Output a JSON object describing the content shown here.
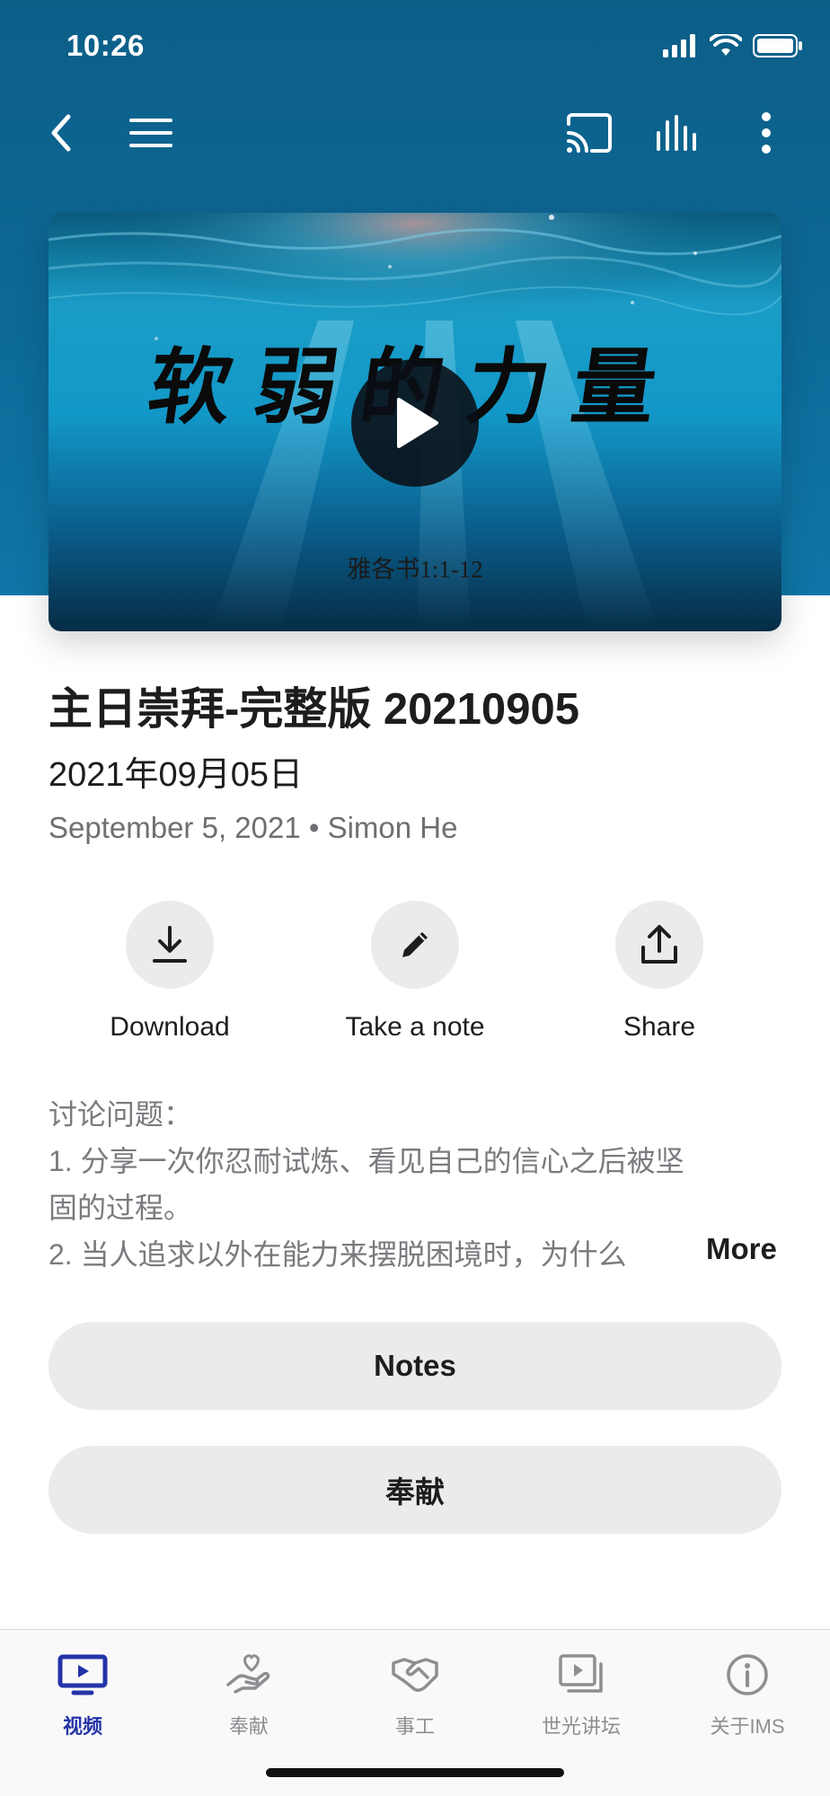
{
  "status_bar": {
    "time": "10:26"
  },
  "video": {
    "calligraphy": "软弱的力量",
    "verse": "雅各书1:1-12"
  },
  "info": {
    "title": "主日崇拜-完整版 20210905",
    "subtitle": "2021年09月05日",
    "meta": "September 5, 2021 • Simon He"
  },
  "actions": [
    {
      "label": "Download",
      "icon": "download-icon"
    },
    {
      "label": "Take a note",
      "icon": "pencil-icon"
    },
    {
      "label": "Share",
      "icon": "share-icon"
    }
  ],
  "description": {
    "lines": [
      "讨论问题：",
      "1. 分享一次你忍耐试炼、看见自己的信心之后被坚",
      "固的过程。",
      "2. 当人追求以外在能力来摆脱困境时，为什么"
    ],
    "more_label": "More"
  },
  "buttons": {
    "notes": "Notes",
    "give": "奉献"
  },
  "tabs": [
    {
      "label": "视频",
      "icon": "video-tv-icon",
      "active": true
    },
    {
      "label": "奉献",
      "icon": "giving-hand-heart-icon",
      "active": false
    },
    {
      "label": "事工",
      "icon": "handshake-icon",
      "active": false
    },
    {
      "label": "世光讲坛",
      "icon": "media-library-icon",
      "active": false
    },
    {
      "label": "关于IMS",
      "icon": "info-icon",
      "active": false
    }
  ],
  "colors": {
    "header": "#0d6a98",
    "accent": "#2433a8",
    "button_bg": "#ebebed"
  }
}
